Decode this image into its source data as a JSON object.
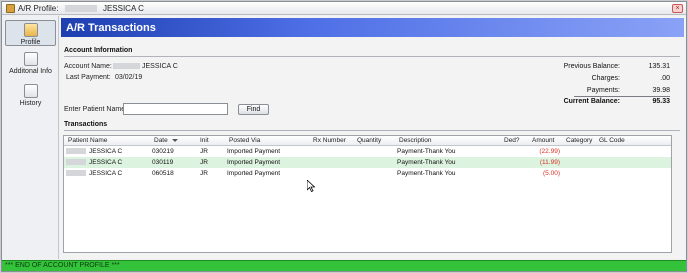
{
  "window": {
    "title_prefix": "A/R Profile:",
    "patient_name": "JESSICA C",
    "close_symbol": "×"
  },
  "nav": {
    "items": [
      {
        "label": "Profile",
        "icon": "profile-icon",
        "active": true
      },
      {
        "label": "Additonal Info",
        "icon": "info-icon",
        "active": false
      },
      {
        "label": "History",
        "icon": "history-icon",
        "active": false
      }
    ]
  },
  "header": {
    "title": "A/R Transactions"
  },
  "account": {
    "section_title": "Account Information",
    "name_label": "Account Name:",
    "name_value": "JESSICA C",
    "last_payment_label": "Last Payment:",
    "last_payment_value": "03/02/19"
  },
  "balances": {
    "previous_label": "Previous Balance:",
    "previous_value": "135.31",
    "charges_label": "Charges:",
    "charges_value": ".00",
    "payments_label": "Payments:",
    "payments_value": "39.98",
    "current_label": "Current Balance:",
    "current_value": "95.33"
  },
  "search": {
    "label": "Enter Patient Name:",
    "value": "",
    "find_label": "Find"
  },
  "transactions": {
    "section_title": "Transactions",
    "columns": [
      "Patient Name",
      "Date",
      "Init",
      "Posted Via",
      "Rx Number",
      "Quantity",
      "Description",
      "Ded?",
      "Amount",
      "Category",
      "GL Code"
    ],
    "rows": [
      {
        "patient": "JESSICA C",
        "date": "030219",
        "init": "JR",
        "posted_via": "Imported Payment",
        "rx": "",
        "qty": "",
        "description": "Payment-Thank You",
        "ded": "",
        "amount": "(22.99)",
        "category": "",
        "gl": ""
      },
      {
        "patient": "JESSICA C",
        "date": "030119",
        "init": "JR",
        "posted_via": "Imported Payment",
        "rx": "",
        "qty": "",
        "description": "Payment-Thank You",
        "ded": "",
        "amount": "(11.99)",
        "category": "",
        "gl": ""
      },
      {
        "patient": "JESSICA C",
        "date": "060518",
        "init": "JR",
        "posted_via": "Imported Payment",
        "rx": "",
        "qty": "",
        "description": "Payment-Thank You",
        "ded": "",
        "amount": "(5.00)",
        "category": "",
        "gl": ""
      }
    ]
  },
  "status": {
    "text": "*** END OF ACCOUNT PROFILE ***"
  },
  "colors": {
    "banner": "#1d3fb0",
    "status_bar": "#35c23b",
    "negative_amount": "#d93025",
    "selected_row": "#dcf3df"
  }
}
